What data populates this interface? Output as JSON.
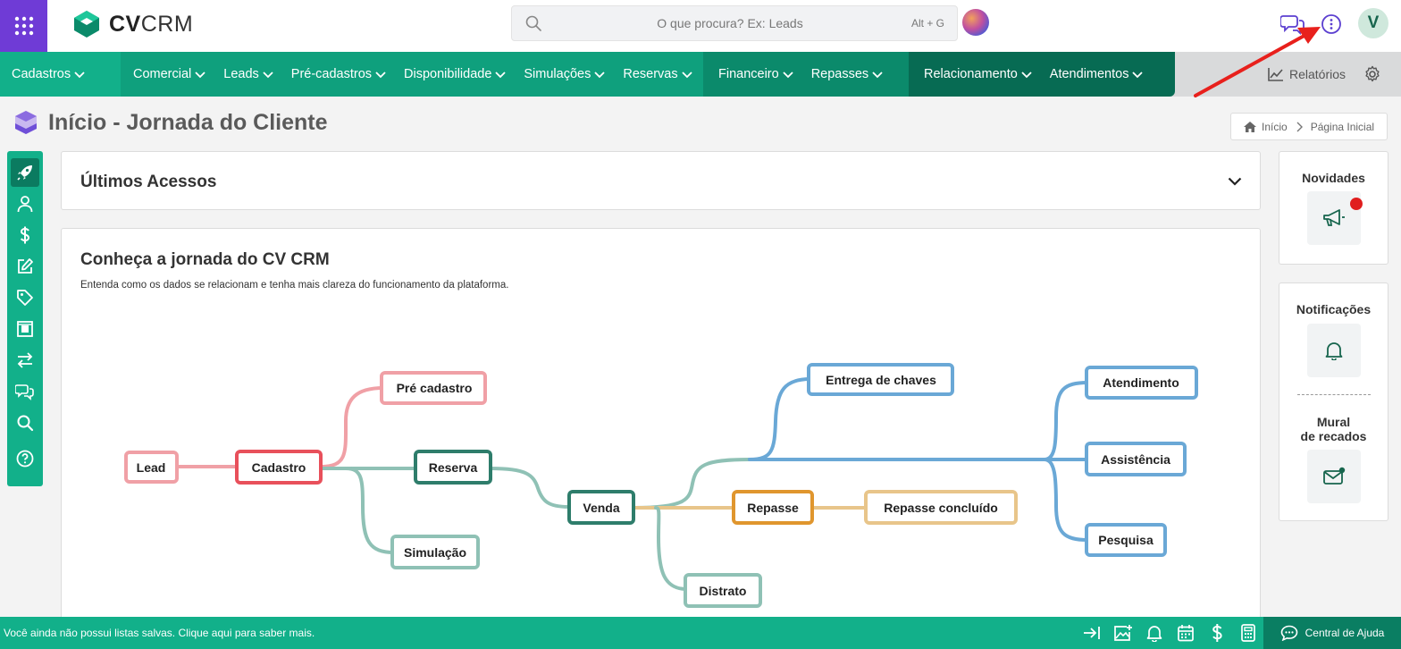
{
  "header": {
    "logo_bold": "CV",
    "logo_rest": "CRM",
    "search_placeholder": "O que procura? Ex: Leads",
    "search_shortcut": "Alt + G",
    "avatar_letter": "V"
  },
  "nav": {
    "cadastros": "Cadastros",
    "comercial": [
      "Comercial",
      "Leads",
      "Pré-cadastros",
      "Disponibilidade",
      "Simulações",
      "Reservas"
    ],
    "financeiro": [
      "Financeiro",
      "Repasses"
    ],
    "relacionamento": [
      "Relacionamento",
      "Atendimentos"
    ],
    "relatorios": "Relatórios"
  },
  "page": {
    "title": "Início - Jornada do Cliente",
    "breadcrumb_home": "Início",
    "breadcrumb_current": "Página Inicial"
  },
  "recent": {
    "title": "Últimos Acessos"
  },
  "journey": {
    "title": "Conheça a jornada do CV CRM",
    "subtitle": "Entenda como os dados se relacionam e tenha mais clareza do funcionamento da plataforma.",
    "nodes": {
      "lead": "Lead",
      "cadastro": "Cadastro",
      "pre_cadastro": "Pré cadastro",
      "reserva": "Reserva",
      "simulacao": "Simulação",
      "venda": "Venda",
      "repasse": "Repasse",
      "repasse_concluido": "Repasse concluído",
      "distrato": "Distrato",
      "entrega_chaves": "Entrega de chaves",
      "atendimento": "Atendimento",
      "assistencia": "Assistência",
      "pesquisa": "Pesquisa"
    }
  },
  "side_panel": {
    "novidades": "Novidades",
    "notificacoes": "Notificações",
    "mural_line1": "Mural",
    "mural_line2": "de recados"
  },
  "footer": {
    "message": "Você ainda não possui listas salvas. Clique aqui para saber mais.",
    "help": "Central de Ajuda"
  },
  "colors": {
    "brand_green": "#12b08a",
    "dark_green": "#0b6b55",
    "purple": "#6f3bd6",
    "pink": "#f0a0a6",
    "red": "#e8505b",
    "teal_dark": "#2e7d6b",
    "teal_light": "#8fc1b5",
    "orange": "#e0962e",
    "sand": "#e8c58a",
    "blue": "#6aa8d6"
  }
}
